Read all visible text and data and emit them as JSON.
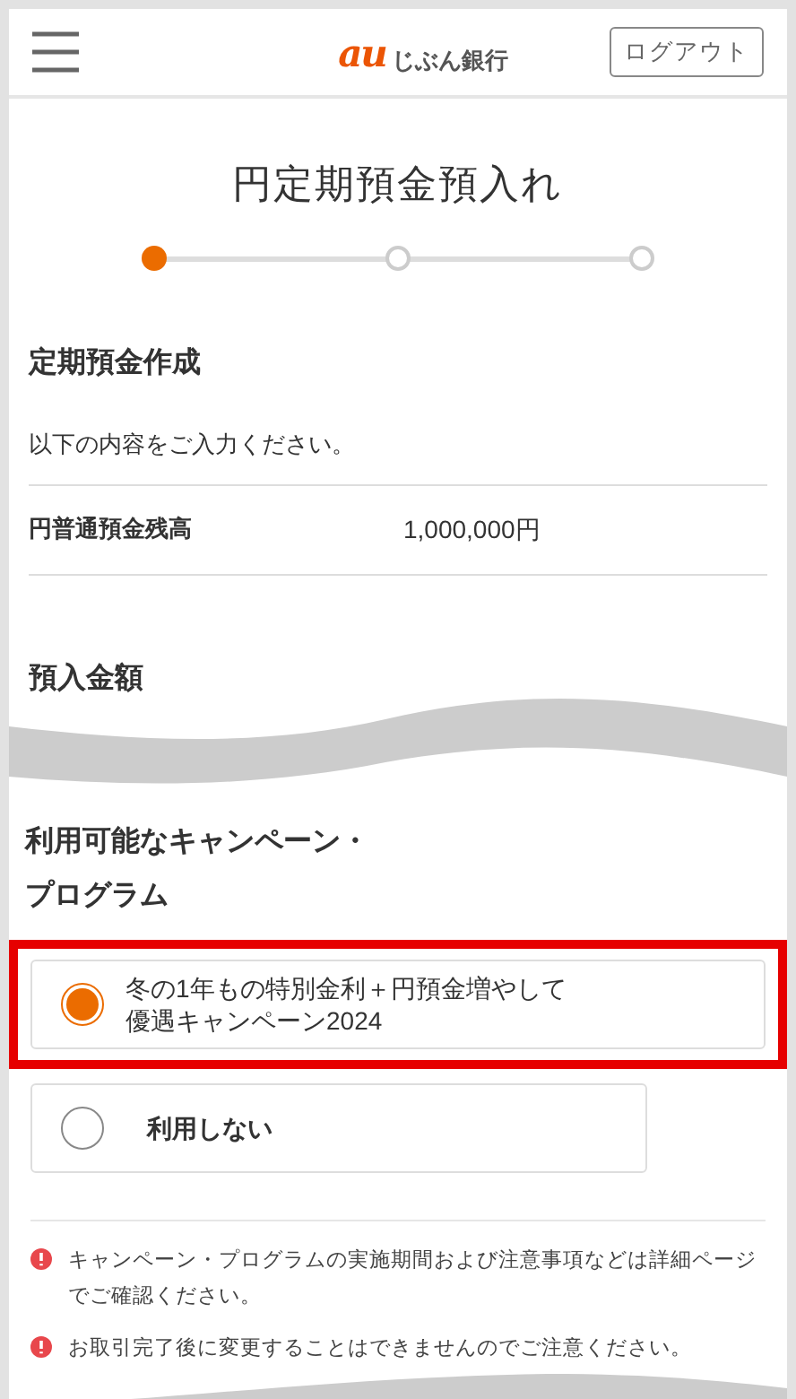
{
  "header": {
    "logo_mark": "au",
    "logo_text": "じぶん銀行",
    "logout_button": "ログアウト"
  },
  "page_title": "円定期預金預入れ",
  "steps": [
    {
      "selected": true
    },
    {
      "selected": false
    },
    {
      "selected": false
    }
  ],
  "section_title": "定期預金作成",
  "instruction": "以下の内容をご入力ください。",
  "balance": {
    "label": "円普通預金残高",
    "value": "1,000,000円"
  },
  "amount_title": "預入金額",
  "campaign_title": "利用可能なキャンペーン・プログラム",
  "options": [
    {
      "label": "冬の1年もの特別金利＋円預金増やして優遇キャンペーン2024",
      "selected": true,
      "highlighted": true
    },
    {
      "label": "利用しない",
      "selected": false,
      "highlighted": false
    }
  ],
  "notes": [
    "キャンペーン・プログラムの実施期間および注意事項などは詳細ページでご確認ください。",
    "お取引完了後に変更することはできませんのでご注意ください。"
  ]
}
